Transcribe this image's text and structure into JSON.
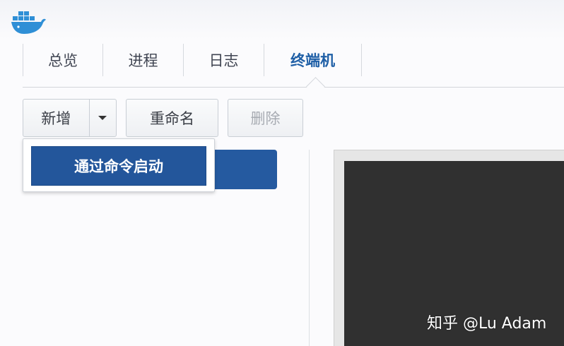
{
  "header": {
    "logo_icon": "docker-whale-icon"
  },
  "tabs": [
    {
      "label": "总览",
      "active": false
    },
    {
      "label": "进程",
      "active": false
    },
    {
      "label": "日志",
      "active": false
    },
    {
      "label": "终端机",
      "active": true
    }
  ],
  "toolbar": {
    "add_label": "新增",
    "rename_label": "重命名",
    "delete_label": "删除"
  },
  "dropdown": {
    "items": [
      {
        "label": "通过命令启动"
      }
    ]
  },
  "watermark": "知乎 @Lu Adam",
  "colors": {
    "accent": "#1f5fa6",
    "menu_bg": "#23569b",
    "terminal_bg": "#303030"
  }
}
